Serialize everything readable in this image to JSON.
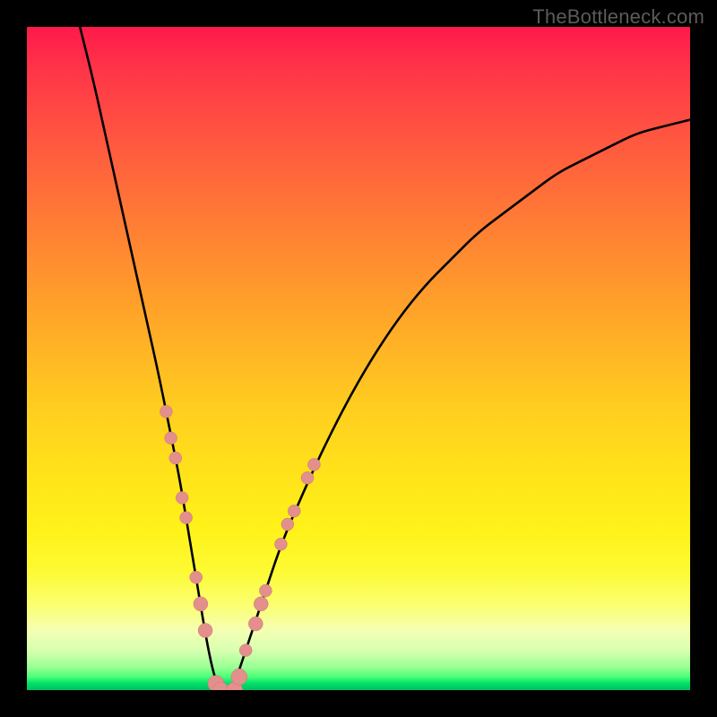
{
  "watermark": {
    "text": "TheBottleneck.com"
  },
  "colors": {
    "frame": "#000000",
    "curve": "#000000",
    "marker_fill": "#e38f8b",
    "marker_stroke": "#c97a76",
    "gradient_top": "#ff194b",
    "gradient_bottom": "#00c060"
  },
  "chart_data": {
    "type": "line",
    "title": "",
    "xlabel": "",
    "ylabel": "",
    "xlim": [
      0,
      100
    ],
    "ylim": [
      0,
      100
    ],
    "grid": false,
    "legend": false,
    "series": [
      {
        "name": "bottleneck-curve",
        "x": [
          8,
          10,
          12,
          14,
          16,
          18,
          20,
          22,
          23,
          24,
          25,
          26,
          27,
          28,
          29,
          30,
          31,
          32,
          34,
          36,
          38,
          40,
          44,
          48,
          52,
          56,
          60,
          64,
          68,
          72,
          76,
          80,
          84,
          88,
          92,
          96,
          100
        ],
        "y": [
          100,
          92,
          83,
          74,
          65,
          56,
          47,
          37,
          32,
          26,
          20,
          14,
          8,
          3,
          0,
          0,
          0,
          3,
          9,
          15,
          21,
          26,
          35,
          43,
          50,
          56,
          61,
          65,
          69,
          72,
          75,
          78,
          80,
          82,
          84,
          85,
          86
        ]
      }
    ],
    "markers": [
      {
        "x": 21.0,
        "y": 42,
        "r": 7
      },
      {
        "x": 21.7,
        "y": 38,
        "r": 7
      },
      {
        "x": 22.4,
        "y": 35,
        "r": 7
      },
      {
        "x": 23.4,
        "y": 29,
        "r": 7
      },
      {
        "x": 24.0,
        "y": 26,
        "r": 7
      },
      {
        "x": 25.5,
        "y": 17,
        "r": 7
      },
      {
        "x": 26.2,
        "y": 13,
        "r": 8
      },
      {
        "x": 26.9,
        "y": 9,
        "r": 8
      },
      {
        "x": 28.5,
        "y": 1,
        "r": 9
      },
      {
        "x": 29.2,
        "y": 0,
        "r": 9
      },
      {
        "x": 31.3,
        "y": 0,
        "r": 9
      },
      {
        "x": 32.0,
        "y": 2,
        "r": 9
      },
      {
        "x": 33.0,
        "y": 6,
        "r": 7
      },
      {
        "x": 34.5,
        "y": 10,
        "r": 8
      },
      {
        "x": 35.3,
        "y": 13,
        "r": 8
      },
      {
        "x": 36.0,
        "y": 15,
        "r": 7
      },
      {
        "x": 38.3,
        "y": 22,
        "r": 7
      },
      {
        "x": 39.3,
        "y": 25,
        "r": 7
      },
      {
        "x": 40.3,
        "y": 27,
        "r": 7
      },
      {
        "x": 42.3,
        "y": 32,
        "r": 7
      },
      {
        "x": 43.3,
        "y": 34,
        "r": 7
      }
    ]
  }
}
